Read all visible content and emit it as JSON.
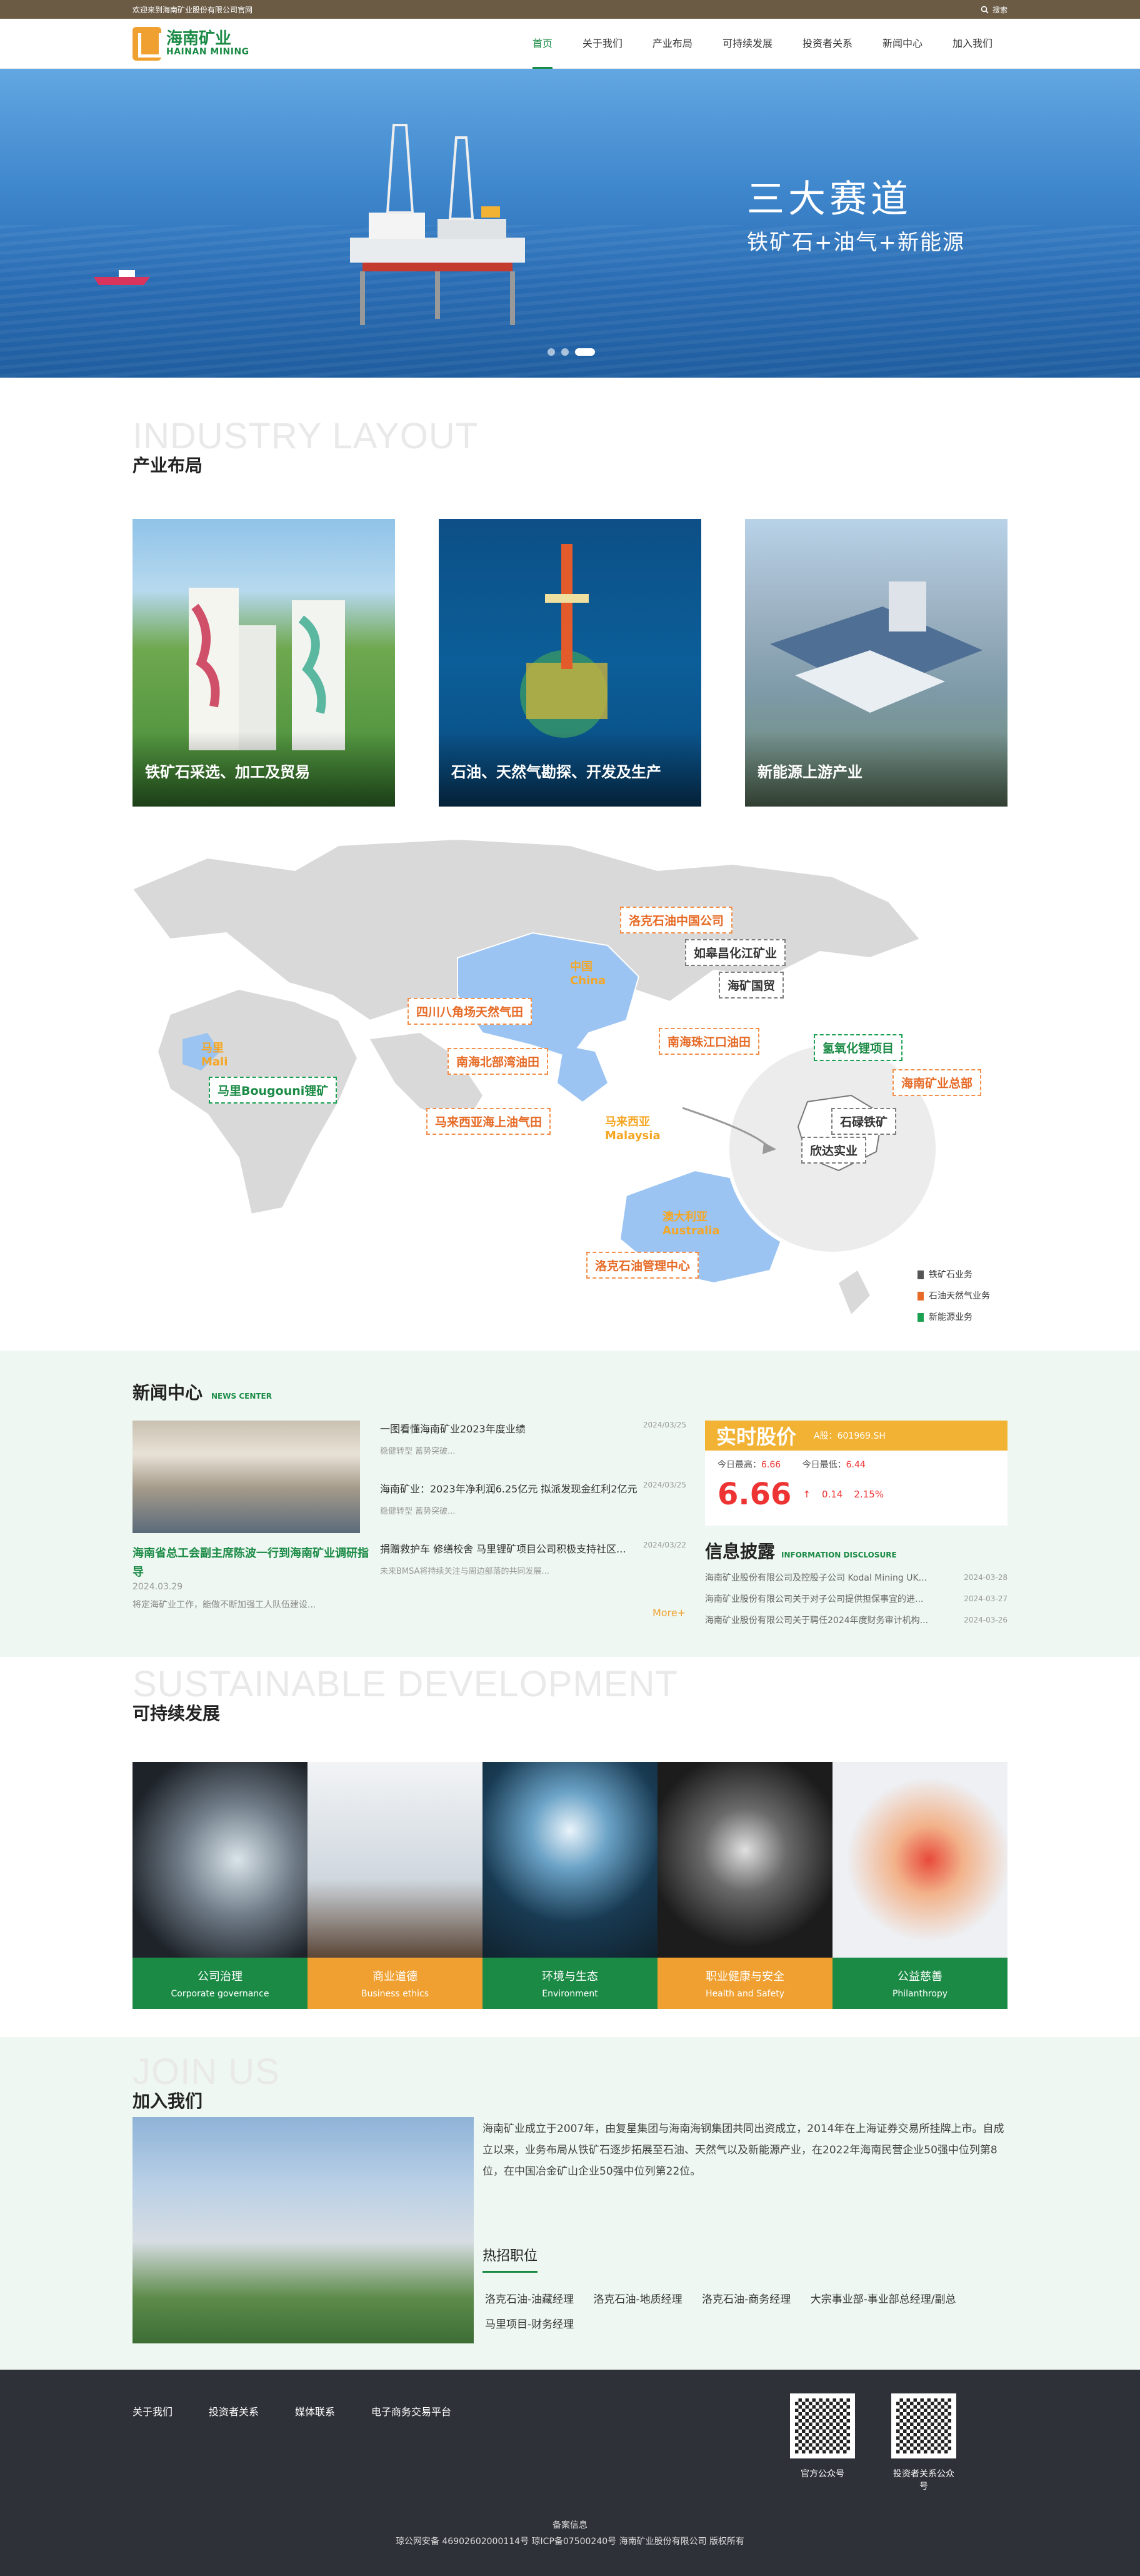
{
  "topbar": {
    "welcome": "欢迎来到海南矿业股份有限公司官网",
    "search": "搜索"
  },
  "logo": {
    "cn": "海南矿业",
    "en": "HAINAN MINING"
  },
  "nav": [
    "首页",
    "关于我们",
    "产业布局",
    "可持续发展",
    "投资者关系",
    "新闻中心",
    "加入我们"
  ],
  "banner": {
    "title": "三大赛道",
    "subtitle": "铁矿石+油气+新能源"
  },
  "industry": {
    "en": "INDUSTRY LAYOUT",
    "cn": "产业布局",
    "cards": [
      "铁矿石采选、加工及贸易",
      "石油、天然气勘探、开发及生产",
      "新能源上游产业"
    ]
  },
  "map": {
    "labels": {
      "luoke_china": "洛克石油中国公司",
      "rugao": "如皋昌化江矿业",
      "haikuang": "海矿国贸",
      "sichuan": "四川八角场天然气田",
      "nanhai_beibu": "南海北部湾油田",
      "nanhai_zhujiang": "南海珠江口油田",
      "malaysia_oil": "马来西亚海上油气田",
      "mali_mine": "马里Bougouni锂矿",
      "luoke_aus": "洛克石油管理中心",
      "qing": "氢氧化锂项目",
      "hq": "海南矿业总部",
      "shilu": "石碌铁矿",
      "xinda": "欣达实业"
    },
    "countries": {
      "china_cn": "中国",
      "china_en": "China",
      "mali_cn": "马里",
      "mali_en": "Mali",
      "my_cn": "马来西亚",
      "my_en": "Malaysia",
      "au_cn": "澳大利亚",
      "au_en": "Australia"
    },
    "legend": [
      "铁矿石业务",
      "石油天然气业务",
      "新能源业务"
    ]
  },
  "news": {
    "title": "新闻中心",
    "title_en": "NEWS CENTER",
    "main": {
      "title": "海南省总工会副主席陈波一行到海南矿业调研指导",
      "date": "2024.03.29",
      "desc": "将定海矿业工作，能做不断加强工人队伍建设..."
    },
    "items": [
      {
        "title": "一图看懂海南矿业2023年度业绩",
        "date": "2024/03/25",
        "desc": "稳健转型 蓄势突破..."
      },
      {
        "title": "海南矿业：2023年净利润6.25亿元 拟派发现金红利2亿元",
        "date": "2024/03/25",
        "desc": "稳健转型 蓄势突破..."
      },
      {
        "title": "捐赠救护车 修缮校舍 马里锂矿项目公司积极支持社区...",
        "date": "2024/03/22",
        "desc": "未来BMSA将持续关注与周边部落的共同发展..."
      }
    ],
    "more": "More+"
  },
  "stock": {
    "label": "实时股价",
    "code": "A股：601969.SH",
    "high_label": "今日最高：",
    "high": "6.66",
    "low_label": "今日最低：",
    "low": "6.44",
    "price": "6.66",
    "change": "0.14",
    "pct": "2.15%"
  },
  "disclosure": {
    "title": "信息披露",
    "title_en": "INFORMATION DISCLOSURE",
    "items": [
      {
        "title": "海南矿业股份有限公司及控股子公司 Kodal Mining UK...",
        "date": "2024-03-28"
      },
      {
        "title": "海南矿业股份有限公司关于对子公司提供担保事宜的进...",
        "date": "2024-03-27"
      },
      {
        "title": "海南矿业股份有限公司关于聘任2024年度财务审计机构...",
        "date": "2024-03-26"
      }
    ]
  },
  "sustain": {
    "en": "SUSTAINABLE DEVELOPMENT",
    "cn": "可持续发展",
    "items": [
      {
        "cn": "公司治理",
        "en": "Corporate governance"
      },
      {
        "cn": "商业道德",
        "en": "Business ethics"
      },
      {
        "cn": "环境与生态",
        "en": "Environment"
      },
      {
        "cn": "职业健康与安全",
        "en": "Health and Safety"
      },
      {
        "cn": "公益慈善",
        "en": "Philanthropy"
      }
    ]
  },
  "join": {
    "en": "JOIN US",
    "cn": "加入我们",
    "text": "海南矿业成立于2007年，由复星集团与海南海钢集团共同出资成立，2014年在上海证券交易所挂牌上市。自成立以来，业务布局从铁矿石逐步拓展至石油、天然气以及新能源产业，在2022年海南民营企业50强中位列第8位，在中国冶金矿山企业50强中位列第22位。",
    "hot": "热招职位",
    "jobs": [
      "洛克石油-油藏经理",
      "洛克石油-地质经理",
      "洛克石油-商务经理",
      "大宗事业部-事业部总经理/副总",
      "马里项目-财务经理"
    ]
  },
  "footer": {
    "links": [
      "关于我们",
      "投资者关系",
      "媒体联系",
      "电子商务交易平台"
    ],
    "qr1": "官方公众号",
    "qr2": "投资者关系公众号",
    "record": "备案信息",
    "icp": "琼公网安备 46902602000114号   琼ICP备07500240号   海南矿业股份有限公司 版权所有"
  }
}
